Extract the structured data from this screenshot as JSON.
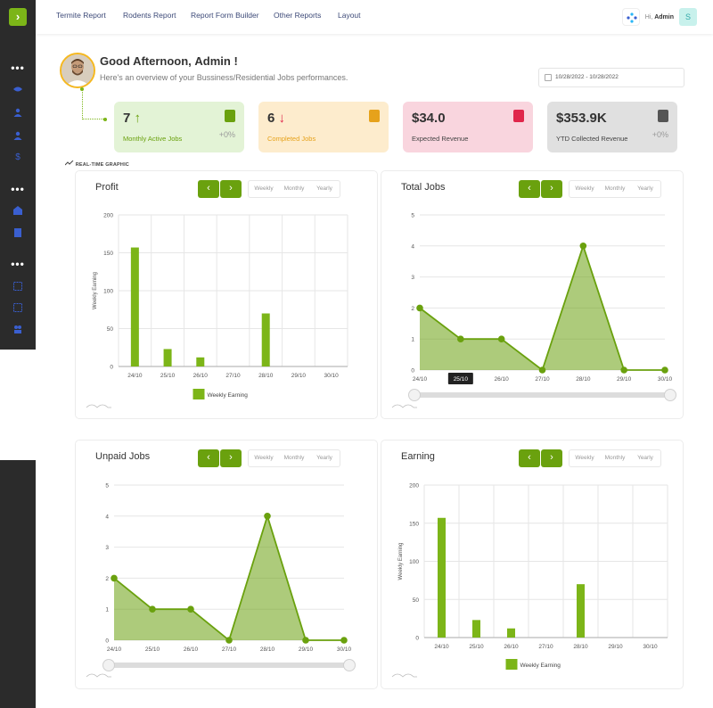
{
  "nav": {
    "items": [
      "Termite Report",
      "Rodents Report",
      "Report Form Builder",
      "Other Reports",
      "Layout"
    ],
    "greeting_prefix": "Hi,",
    "user_name": "Admin",
    "avatar_letter": "S"
  },
  "sidebar": {
    "logo_glyph": "›",
    "dots": "•••",
    "icons": [
      "eye-icon",
      "user-icon",
      "user-icon",
      "dollar-icon",
      "home-icon",
      "book-icon",
      "grid-icon",
      "grid-icon",
      "users-icon"
    ]
  },
  "header": {
    "title_prefix": "Good Afternoon, ",
    "title_name": "Admin !",
    "subtitle": "Here's an overview of your Bussiness/Residential Jobs performances.",
    "date_range": "10/28/2022 - 10/28/2022"
  },
  "stats": [
    {
      "value": "7",
      "arrow": "↑",
      "label": "Monthly Active Jobs",
      "pct": "+0%",
      "bg": "#e3f3d6",
      "label_color": "#6aa10e",
      "icon_color": "#6aa10e"
    },
    {
      "value": "6",
      "arrow": "↓",
      "label": "Completed Jobs",
      "pct": "",
      "bg": "#fdeccd",
      "label_color": "#e6a21b",
      "icon_color": "#e6a21b"
    },
    {
      "value": "$34.0",
      "arrow": "",
      "label": "Expected Revenue",
      "pct": "",
      "bg": "#f9d5de",
      "label_color": "#444",
      "icon_color": "#e0264b"
    },
    {
      "value": "$353.9K",
      "arrow": "",
      "label": "YTD Collected Revenue",
      "pct": "+0%",
      "bg": "#e0e0e0",
      "label_color": "#444",
      "icon_color": "#555"
    }
  ],
  "realtime_label": "REAL-TIME GRAPHIC",
  "period_options": [
    "Weekly",
    "Monthly",
    "Yearly"
  ],
  "cards": {
    "profit": {
      "title": "Profit"
    },
    "total_jobs": {
      "title": "Total Jobs"
    },
    "unpaid_jobs": {
      "title": "Unpaid Jobs"
    },
    "earning": {
      "title": "Earning"
    }
  },
  "tooltip": "25/10",
  "chart_data": [
    {
      "type": "bar",
      "title": "Profit",
      "ylabel": "Weekly Earning",
      "categories": [
        "24/10",
        "25/10",
        "26/10",
        "27/10",
        "28/10",
        "29/10",
        "30/10"
      ],
      "series": [
        {
          "name": "Weekly Earning",
          "values": [
            157,
            23,
            12,
            0,
            70,
            0,
            0
          ]
        }
      ],
      "ylim": [
        0,
        200
      ],
      "yticks": [
        0,
        50,
        100,
        150,
        200
      ],
      "color": "#7cb518",
      "legend": "bottom"
    },
    {
      "type": "area",
      "title": "Total Jobs",
      "categories": [
        "24/10",
        "25/10",
        "26/10",
        "27/10",
        "28/10",
        "29/10",
        "30/10"
      ],
      "series": [
        {
          "values": [
            2,
            1,
            1,
            0,
            4,
            0,
            0
          ]
        }
      ],
      "ylim": [
        0,
        5
      ],
      "yticks": [
        0,
        1,
        2,
        3,
        4,
        5
      ],
      "color": "#6aa10e"
    },
    {
      "type": "area",
      "title": "Unpaid Jobs",
      "categories": [
        "24/10",
        "25/10",
        "26/10",
        "27/10",
        "28/10",
        "29/10",
        "30/10"
      ],
      "series": [
        {
          "values": [
            2,
            1,
            1,
            0,
            4,
            0,
            0
          ]
        }
      ],
      "ylim": [
        0,
        5
      ],
      "yticks": [
        0,
        1,
        2,
        3,
        4,
        5
      ],
      "color": "#6aa10e"
    },
    {
      "type": "bar",
      "title": "Earning",
      "ylabel": "Weekly Earning",
      "categories": [
        "24/10",
        "25/10",
        "26/10",
        "27/10",
        "28/10",
        "29/10",
        "30/10"
      ],
      "series": [
        {
          "name": "Weekly Earning",
          "values": [
            157,
            23,
            12,
            0,
            70,
            0,
            0
          ]
        }
      ],
      "ylim": [
        0,
        200
      ],
      "yticks": [
        0,
        50,
        100,
        150,
        200
      ],
      "color": "#7cb518",
      "legend": "bottom"
    }
  ]
}
